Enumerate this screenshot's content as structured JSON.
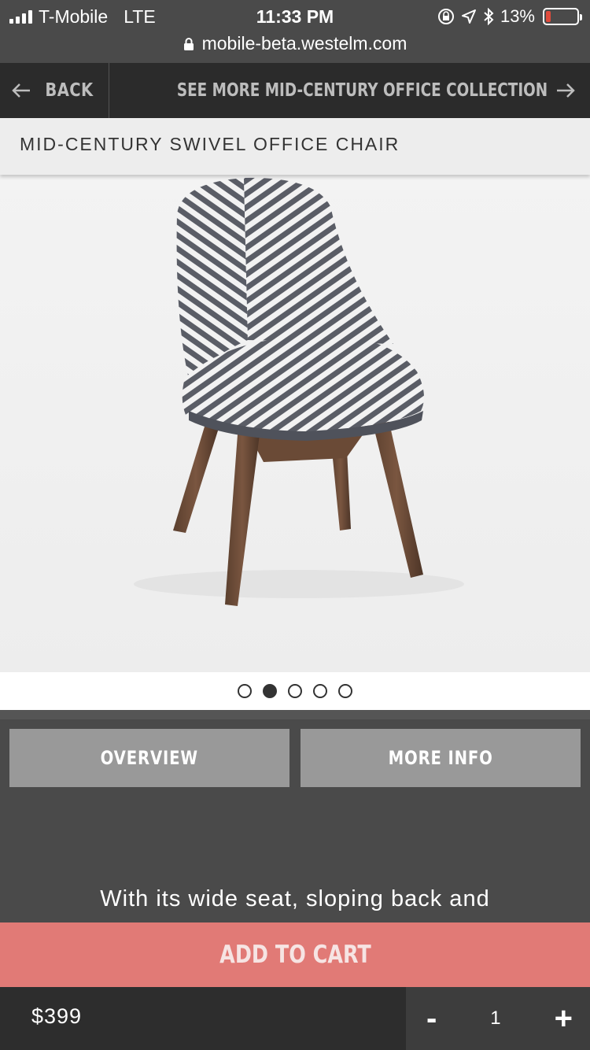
{
  "status_bar": {
    "carrier": "T-Mobile",
    "network": "LTE",
    "time": "11:33 PM",
    "battery": "13%",
    "url": "mobile-beta.westelm.com"
  },
  "nav": {
    "back_label": "BACK",
    "see_more_label": "SEE MORE MID-CENTURY OFFICE COLLECTION"
  },
  "product": {
    "title": "MID-CENTURY SWIVEL OFFICE CHAIR",
    "gallery": {
      "total": 5,
      "active_index": 1
    }
  },
  "tabs": [
    {
      "label": "OVERVIEW"
    },
    {
      "label": "MORE INFO"
    }
  ],
  "description": "With its wide seat, sloping back and",
  "cart": {
    "add_label": "ADD TO CART",
    "price": "$399",
    "quantity": "1",
    "minus_label": "-",
    "plus_label": "+"
  },
  "colors": {
    "add_to_cart": "#e17a76",
    "nav_bg": "#2b2b2b",
    "content_bg": "#4a4a4a"
  }
}
